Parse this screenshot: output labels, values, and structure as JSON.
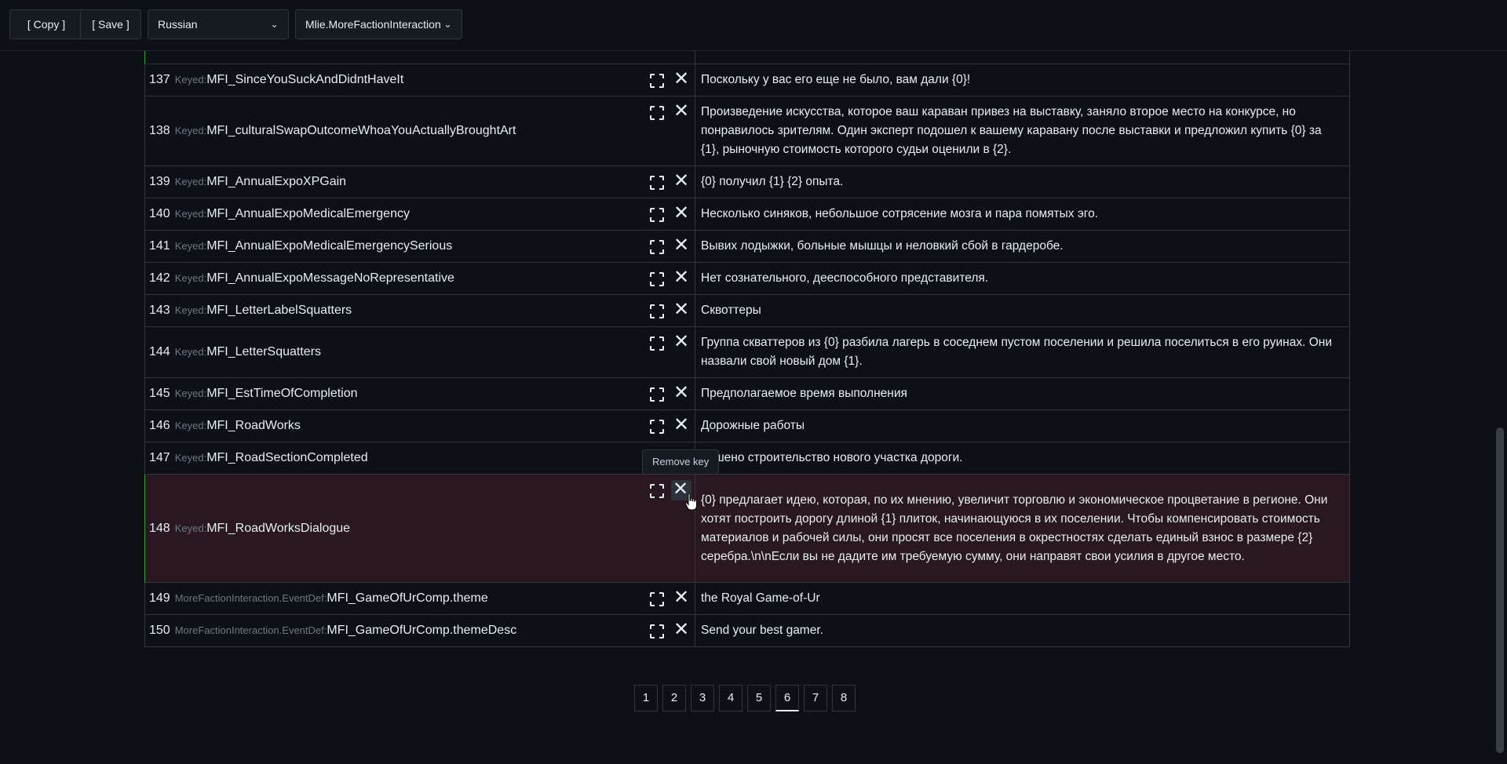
{
  "toolbar": {
    "copy_label": "[ Copy ]",
    "save_label": "[ Save ]",
    "language": "Russian",
    "mod": "Mlie.MoreFactionInteraction"
  },
  "tooltip": "Remove key",
  "rows": [
    {
      "num": "137",
      "ns": "Keyed:",
      "key": "MFI_SinceYouSuckAndDidntHaveIt",
      "value": "Поскольку у вас его еще не было, вам дали {0}!"
    },
    {
      "num": "138",
      "ns": "Keyed:",
      "key": "MFI_culturalSwapOutcomeWhoaYouActuallyBroughtArt",
      "value": "Произведение искусства, которое ваш караван привез на выставку, заняло второе место на конкурсе, но понравилось зрителям. Один эксперт подошел к вашему каравану после выставки и предложил купить {0} за {1}, рыночную стоимость которого судьи оценили в {2}."
    },
    {
      "num": "139",
      "ns": "Keyed:",
      "key": "MFI_AnnualExpoXPGain",
      "value": "{0} получил {1} {2} опыта."
    },
    {
      "num": "140",
      "ns": "Keyed:",
      "key": "MFI_AnnualExpoMedicalEmergency",
      "value": "Несколько синяков, небольшое сотрясение мозга и пара помятых эго."
    },
    {
      "num": "141",
      "ns": "Keyed:",
      "key": "MFI_AnnualExpoMedicalEmergencySerious",
      "value": "Вывих лодыжки, больные мышцы и неловкий сбой в гардеробе."
    },
    {
      "num": "142",
      "ns": "Keyed:",
      "key": "MFI_AnnualExpoMessageNoRepresentative",
      "value": "Нет сознательного, дееспособного представителя."
    },
    {
      "num": "143",
      "ns": "Keyed:",
      "key": "MFI_LetterLabelSquatters",
      "value": "Сквоттеры"
    },
    {
      "num": "144",
      "ns": "Keyed:",
      "key": "MFI_LetterSquatters",
      "value": "Группа скваттеров из {0} разбила лагерь в соседнем пустом поселении и решила поселиться в его руинах. Они назвали свой новый дом {1}."
    },
    {
      "num": "145",
      "ns": "Keyed:",
      "key": "MFI_EstTimeOfCompletion",
      "value": "Предполагаемое время выполнения"
    },
    {
      "num": "146",
      "ns": "Keyed:",
      "key": "MFI_RoadWorks",
      "value": "Дорожные работы"
    },
    {
      "num": "147",
      "ns": "Keyed:",
      "key": "MFI_RoadSectionCompleted",
      "value": "ершено строительство нового участка дороги."
    },
    {
      "num": "148",
      "ns": "Keyed:",
      "key": "MFI_RoadWorksDialogue",
      "value": "{0} предлагает идею, которая, по их мнению, увеличит торговлю и экономическое процветание в регионе. Они хотят построить дорогу длиной {1} плиток, начинающуюся в их поселении. Чтобы компенсировать стоимость материалов и рабочей силы, они просят все поселения в окрестностях сделать единый взнос в размере {2} серебра.\\n\\nЕсли вы не дадите им требуемую сумму, они направят свои усилия в другое место."
    },
    {
      "num": "149",
      "ns": "MoreFactionInteraction.EventDef:",
      "key": "MFI_GameOfUrComp.theme",
      "value": "the Royal Game-of-Ur"
    },
    {
      "num": "150",
      "ns": "MoreFactionInteraction.EventDef:",
      "key": "MFI_GameOfUrComp.themeDesc",
      "value": "Send your best gamer."
    }
  ],
  "pagination": {
    "pages": [
      "1",
      "2",
      "3",
      "4",
      "5",
      "6",
      "7",
      "8"
    ],
    "current": "6"
  }
}
